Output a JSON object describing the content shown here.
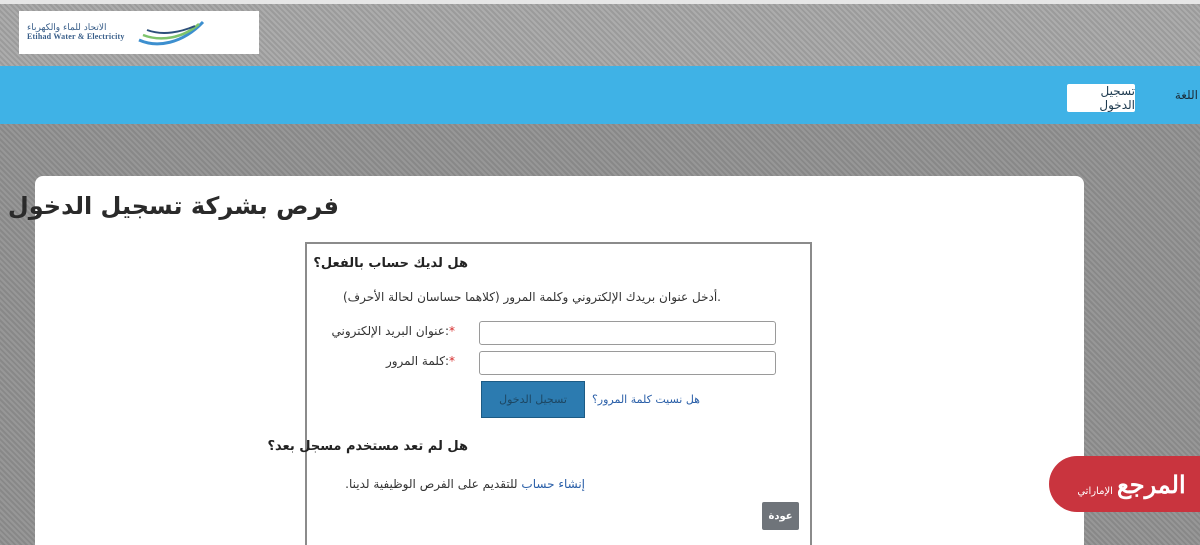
{
  "header": {
    "logo_ar": "الاتحاد للماء والكهرباء",
    "logo_en": "Etihad Water & Electricity"
  },
  "nav": {
    "language": "اللغة",
    "login": "تسجيل الدخول",
    "bar_color": "#3fb2e6"
  },
  "page": {
    "title": "فرص بشركة تسجيل الدخول"
  },
  "login_form": {
    "heading": "هل لديك حساب بالفعل؟",
    "instructions": ".أدخل عنوان بريدك الإلكتروني وكلمة المرور (كلاهما حساسان لحالة الأحرف)",
    "email_label": ":عنوان البريد الإلكتروني",
    "email_value": "",
    "password_label": ":كلمة المرور",
    "password_value": "",
    "required_marker": "*",
    "submit_label": "تسجيل الدخول",
    "forgot_password": "هل نسيت كلمة المرور؟"
  },
  "register": {
    "heading": "هل لم تعد مستخدم مسجل بعد؟",
    "link_text": "إنشاء حساب",
    "suffix_text": "للتقديم على الفرص الوظيفية لدينا",
    "trailing": ".",
    "back_label": "عودة"
  },
  "watermark": {
    "main": "المرجع",
    "sub": "الإماراتي",
    "color": "#c9343e"
  }
}
